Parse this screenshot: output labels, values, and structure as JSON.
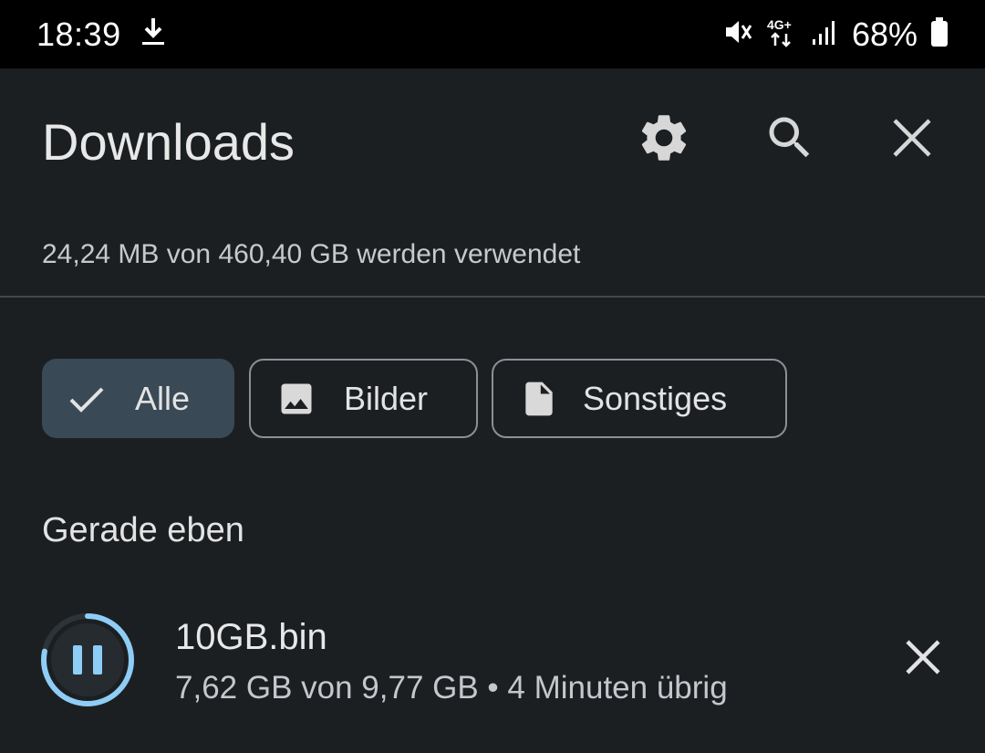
{
  "status_bar": {
    "time": "18:39",
    "battery_percent": "68%",
    "network_type": "4G+",
    "icons": [
      "download-icon",
      "mute-icon",
      "network-icon",
      "signal-icon",
      "battery-icon"
    ]
  },
  "header": {
    "title": "Downloads",
    "icons": [
      "settings-icon",
      "search-icon",
      "close-icon"
    ]
  },
  "storage": {
    "text": "24,24 MB von 460,40 GB werden verwendet"
  },
  "filters": [
    {
      "label": "Alle",
      "icon": "check-icon",
      "selected": true
    },
    {
      "label": "Bilder",
      "icon": "image-icon",
      "selected": false
    },
    {
      "label": "Sonstiges",
      "icon": "file-icon",
      "selected": false
    }
  ],
  "section": {
    "heading": "Gerade eben"
  },
  "download": {
    "file_name": "10GB.bin",
    "progress_text": "7,62 GB von 9,77 GB • 4 Minuten übrig",
    "progress_fraction": 0.78,
    "state": "downloading",
    "icons": [
      "pause-icon",
      "cancel-icon"
    ]
  },
  "colors": {
    "background": "#1c1f22",
    "status_bar": "#000000",
    "chip_selected": "#394955",
    "progress_ring": "#8ecdf6"
  }
}
